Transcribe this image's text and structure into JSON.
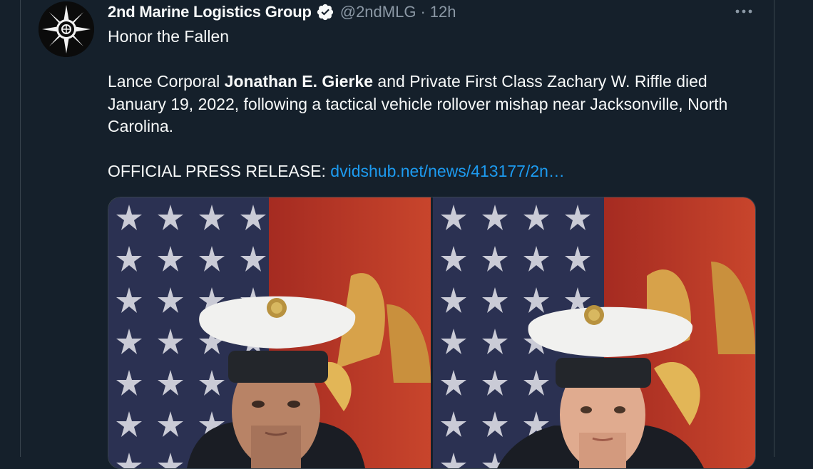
{
  "tweet": {
    "author": {
      "display_name": "2nd Marine Logistics Group",
      "handle": "@2ndMLG",
      "verified": true,
      "avatar_icon": "unit-emblem-icon"
    },
    "separator": "·",
    "time": "12h",
    "more_icon": "more-options-icon",
    "text": {
      "line1": "Honor the Fallen",
      "para2_prefix": "Lance Corporal ",
      "para2_bold": "Jonathan E. Gierke",
      "para2_suffix": " and Private First Class Zachary W. Riffle died January 19, 2022, following a tactical vehicle rollover mishap near Jacksonville, North Carolina.",
      "press_label": "OFFICIAL PRESS RELEASE: ",
      "press_link": "dvidshub.net/news/413177/2n…"
    },
    "media": {
      "photos": [
        "portrait-photo-left",
        "portrait-photo-right"
      ]
    }
  },
  "colors": {
    "background": "#15202b",
    "text": "#f7f9f9",
    "secondary": "#8b98a5",
    "link": "#1d9bf0",
    "verified": "#f7f9f9"
  }
}
